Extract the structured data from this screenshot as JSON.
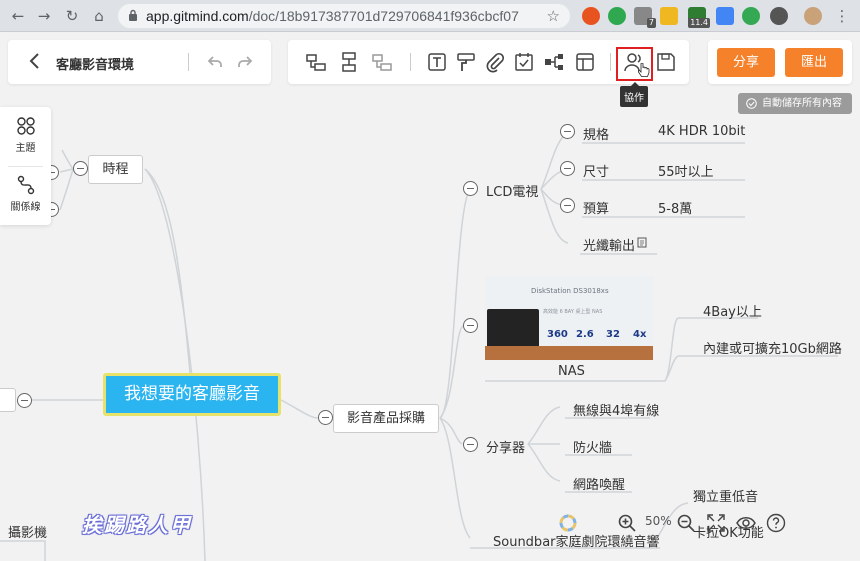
{
  "browser": {
    "url_host": "app.gitmind.com",
    "url_path": "/doc/18b917387701d729706841f936cbcf07",
    "ext_badge_mail": "7",
    "ext_badge_num": "11.4"
  },
  "header": {
    "doc_title": "客廳影音環境",
    "share_label": "分享",
    "export_label": "匯出",
    "tooltip": "協作",
    "autosave": "自動儲存所有內容"
  },
  "side": {
    "theme_label": "主題",
    "relation_label": "關係線"
  },
  "mindmap": {
    "central": "我想要的客廳影音",
    "schedule": "時程",
    "purchase": "影音產品採購",
    "camera": "攝影機",
    "lcd": "LCD電視",
    "lcd_items": [
      {
        "label": "規格",
        "value": "4K HDR 10bit"
      },
      {
        "label": "尺寸",
        "value": "55吋以上"
      },
      {
        "label": "預算",
        "value": "5-8萬"
      }
    ],
    "lcd_optical": "光纖輸出",
    "nas_label": "NAS",
    "nas_image": {
      "model": "DiskStation DS3018xs",
      "subtitle": "高效能 6 BAY 桌上型 NAS",
      "stats": [
        "360",
        "2.6",
        "32",
        "4x"
      ]
    },
    "nas_children": [
      "4Bay以上",
      "內建或可擴充10Gb網路"
    ],
    "router": "分享器",
    "router_children": [
      "無線與4埠有線",
      "防火牆",
      "網路喚醒"
    ],
    "soundbar": "Soundbar家庭劇院環繞音響",
    "soundbar_children": [
      "獨立重低音",
      "卡拉OK功能"
    ]
  },
  "zoom": {
    "level": "50%"
  },
  "watermark": "挨踢路人甲",
  "colors": {
    "accent_orange": "#f5812a",
    "central_fill": "#2ab4f0",
    "central_border": "#e7e36a",
    "highlight_red": "#e02020"
  }
}
